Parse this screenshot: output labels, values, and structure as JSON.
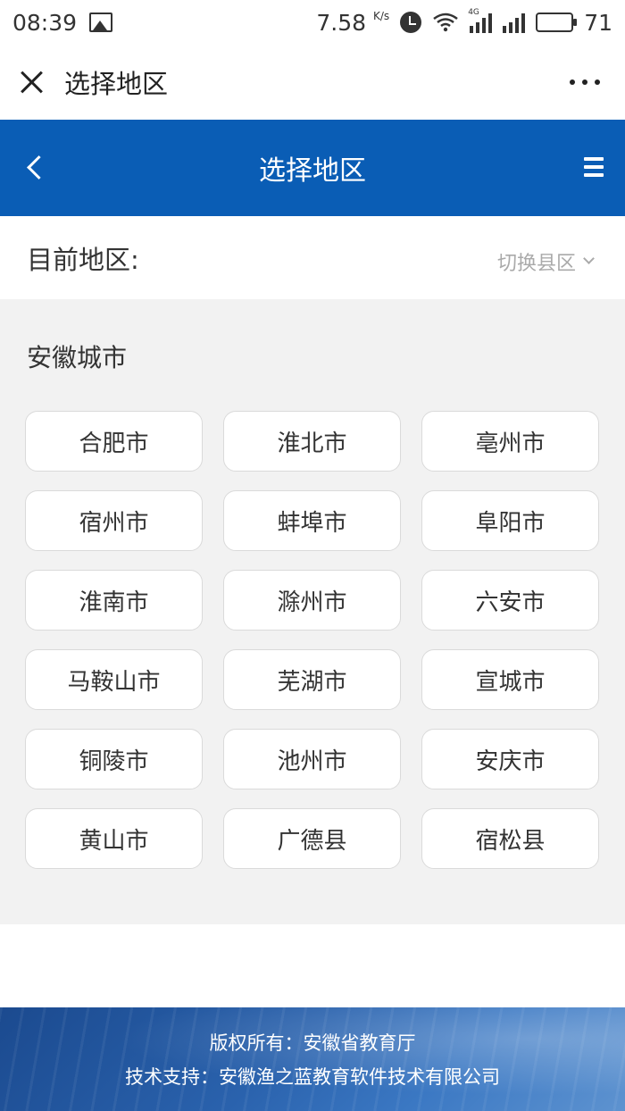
{
  "status_bar": {
    "time": "08:39",
    "speed_value": "7.58",
    "speed_unit": "K/s",
    "network_tag": "4G",
    "battery": "71"
  },
  "wechat_bar": {
    "title": "选择地区"
  },
  "header": {
    "title": "选择地区",
    "accent_color": "#0a5db5"
  },
  "current_region": {
    "label": "目前地区:",
    "switch_label": "切换县区"
  },
  "cities": {
    "title": "安徽城市",
    "items": [
      "合肥市",
      "淮北市",
      "亳州市",
      "宿州市",
      "蚌埠市",
      "阜阳市",
      "淮南市",
      "滁州市",
      "六安市",
      "马鞍山市",
      "芜湖市",
      "宣城市",
      "铜陵市",
      "池州市",
      "安庆市",
      "黄山市",
      "广德县",
      "宿松县"
    ]
  },
  "footer": {
    "copyright": "版权所有：安徽省教育厅",
    "support": "技术支持：安徽渔之蓝教育软件技术有限公司"
  }
}
